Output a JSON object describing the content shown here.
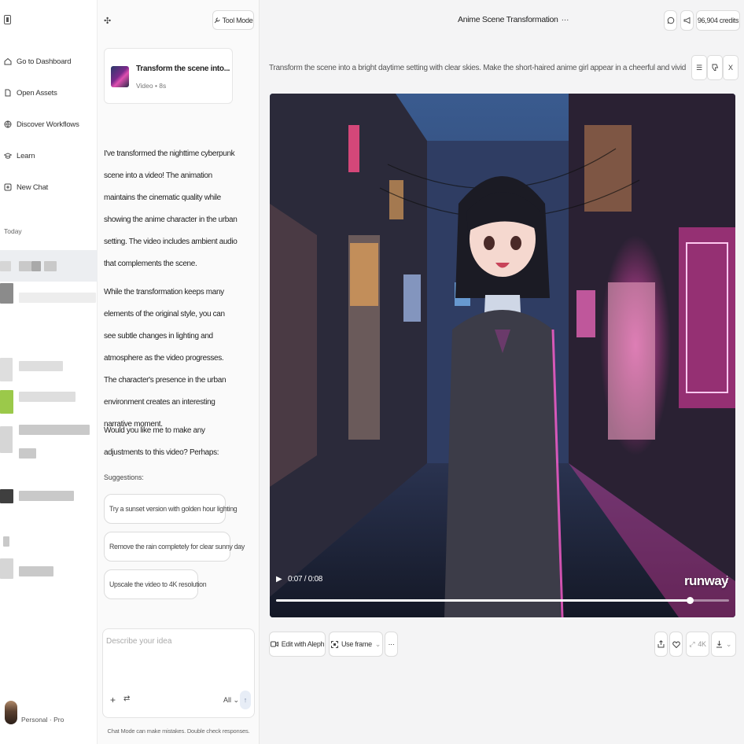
{
  "sidebar": {
    "logo_icon": "sidebar-toggle-icon",
    "items": [
      {
        "label": "Go to Dashboard",
        "icon": "home-icon"
      },
      {
        "label": "Open Assets",
        "icon": "file-icon"
      },
      {
        "label": "Discover Workflows",
        "icon": "globe-icon"
      },
      {
        "label": "Learn",
        "icon": "graduation-cap-icon"
      },
      {
        "label": "New Chat",
        "icon": "plus-square-icon"
      }
    ],
    "section_today": "Today",
    "user_label": "Personal · Pro"
  },
  "chat": {
    "tool_mode_label": "Tool Mode",
    "asset": {
      "title": "Transform the scene into...",
      "subtitle": "Video • 8s"
    },
    "messages": [
      "I've transformed the nighttime cyberpunk scene into a video! The animation maintains the cinematic quality while showing the anime character in the urban setting. The video includes ambient audio that complements the scene.",
      "While the transformation keeps many elements of the original style, you can see subtle changes in lighting and atmosphere as the video progresses. The character's presence in the urban environment creates an interesting narrative moment.",
      "Would you like me to make any adjustments to this video? Perhaps:"
    ],
    "suggestions_label": "Suggestions:",
    "suggestions": [
      "Try a sunset version with golden hour lighting",
      "Remove the rain completely for clear sunny day",
      "Upscale the video to 4K resolution"
    ],
    "composer": {
      "placeholder": "Describe your idea",
      "filter_label": "All"
    },
    "disclaimer": "Chat Mode can make mistakes. Double check responses."
  },
  "main": {
    "title": "Anime Scene Transformation",
    "title_more": "···",
    "credits": "96,904 credits",
    "prompt": "Transform the scene into a bright daytime setting with clear skies. Make the short-haired anime girl appear in a cheerful and vivid anime style, with sof...",
    "close_label": "X",
    "video": {
      "time": "0:07 / 0:08",
      "progress_fraction": 0.914,
      "watermark": "runway"
    },
    "actions": {
      "edit_label": "Edit with Aleph",
      "use_frame_label": "Use frame",
      "more_label": "···",
      "upscale_label": "4K"
    }
  },
  "colors": {
    "neon_pink": "#ff3fb4",
    "night_blue": "#2a3a66",
    "panel_bg": "#f4f4f5"
  }
}
